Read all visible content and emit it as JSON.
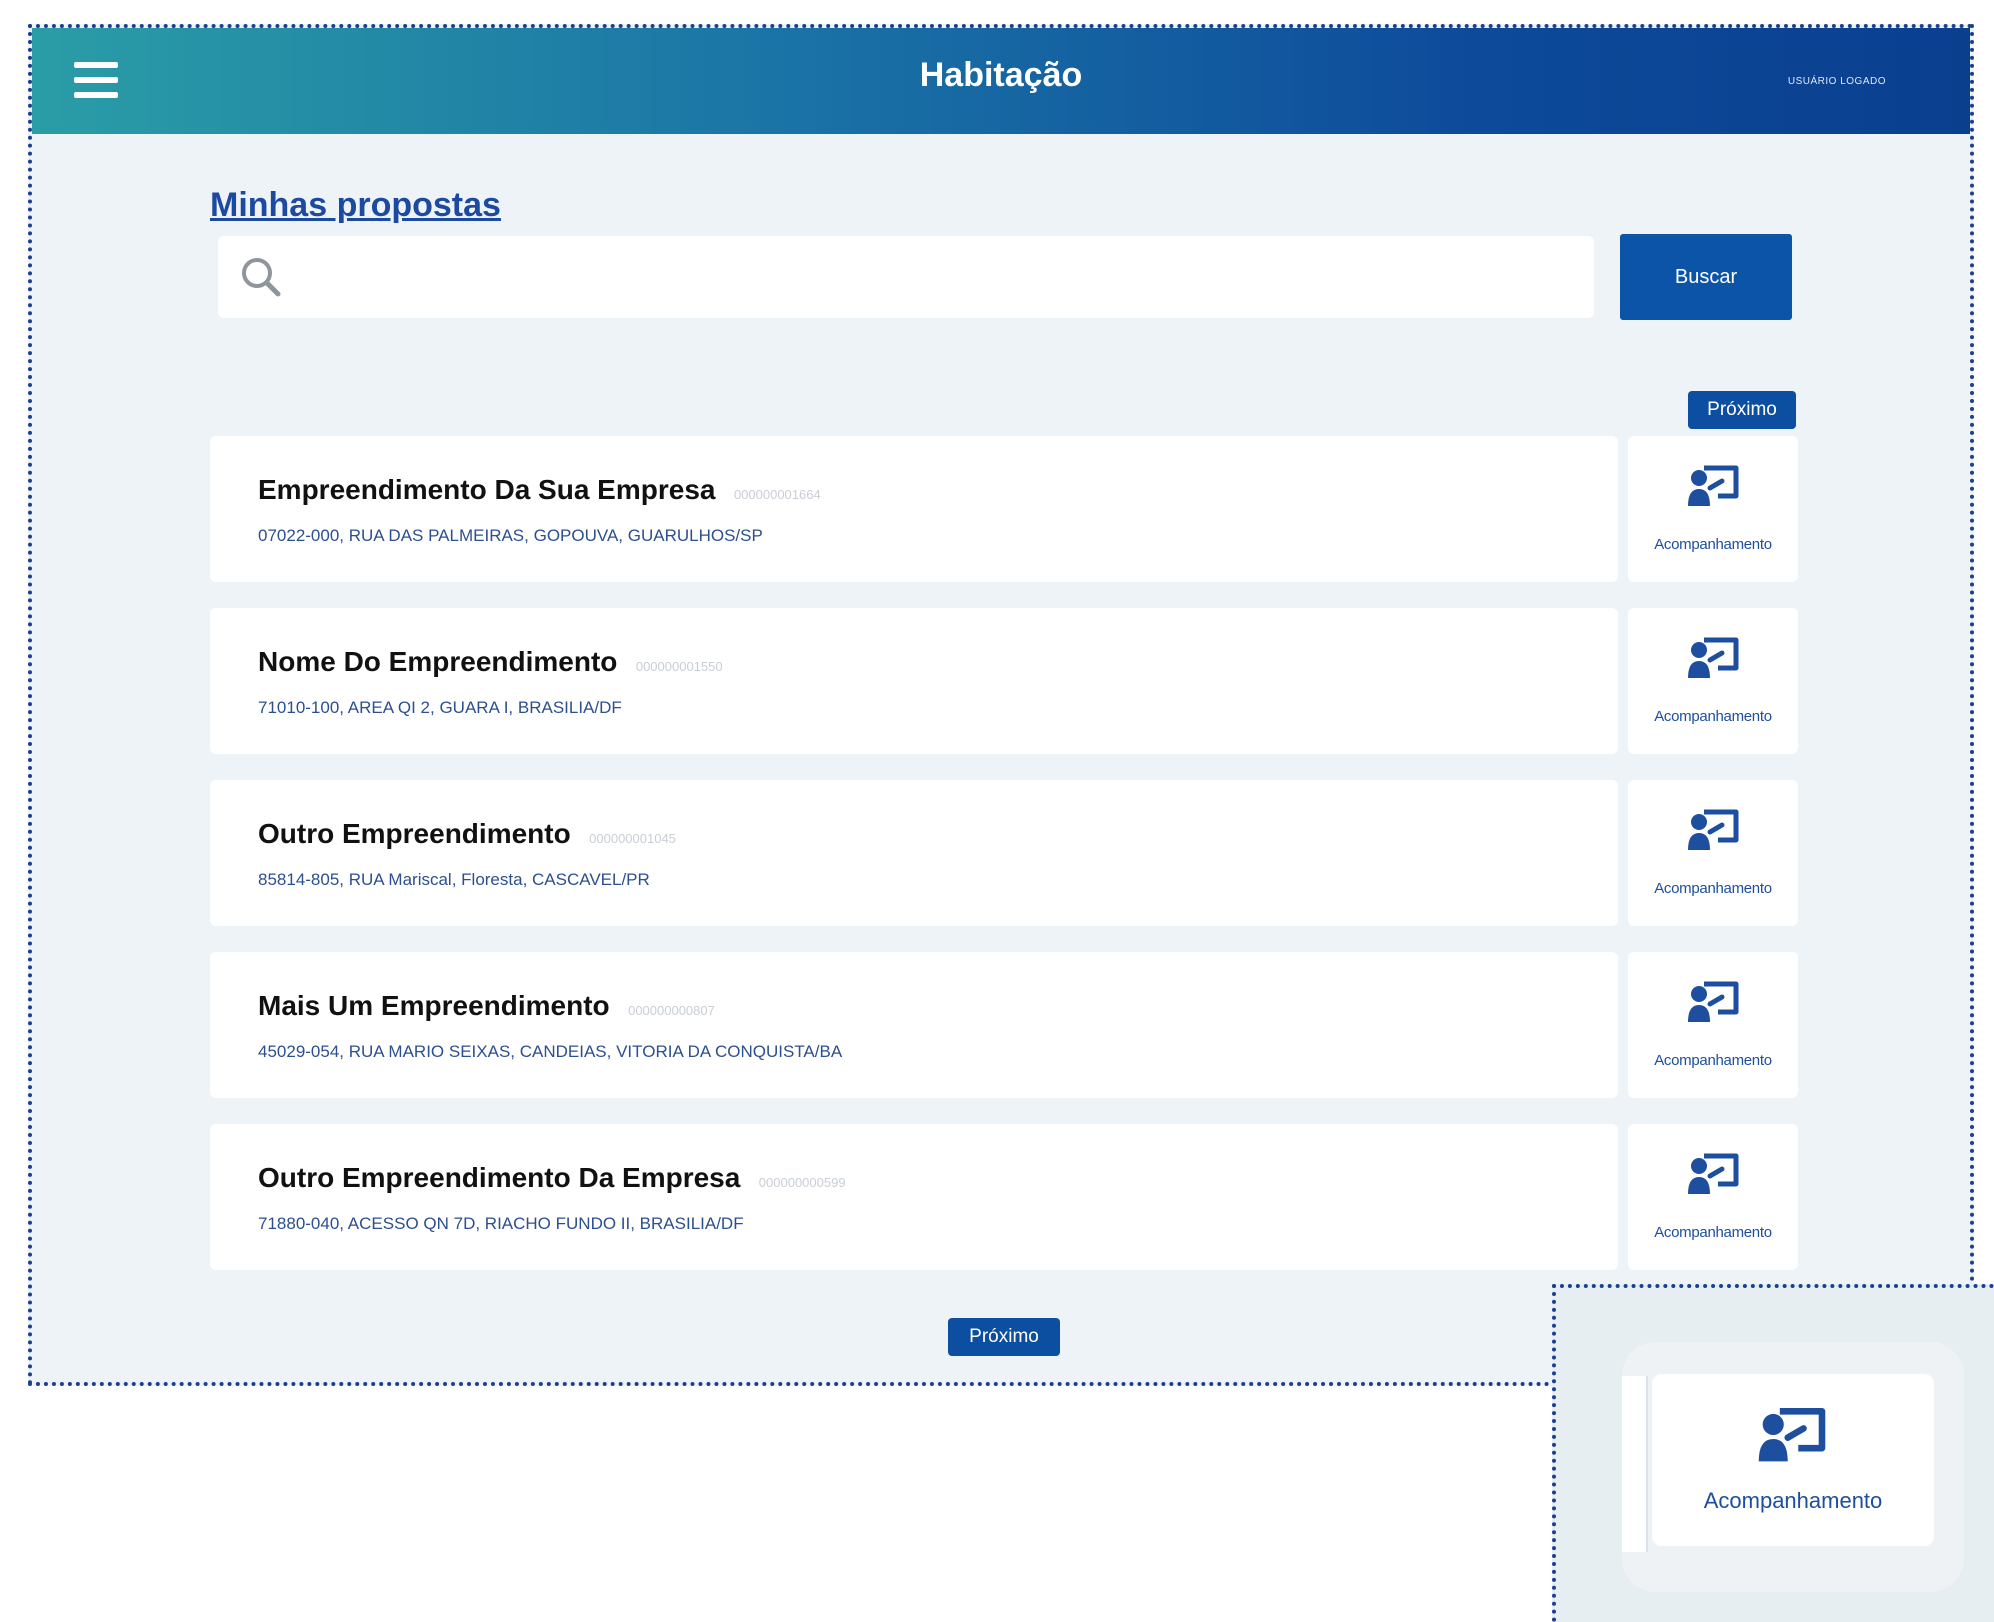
{
  "header": {
    "title": "Habitação",
    "user_text": "USUÁRIO LOGADO"
  },
  "page": {
    "title": "Minhas propostas"
  },
  "search": {
    "placeholder": "",
    "value": "",
    "button_label": "Buscar"
  },
  "pagination": {
    "next_label": "Próximo"
  },
  "proposals": [
    {
      "name": "Empreendimento Da Sua Empresa",
      "code": "000000001664",
      "address": "07022-000, RUA DAS PALMEIRAS, GOPOUVA, GUARULHOS/SP",
      "action_label": "Acompanhamento"
    },
    {
      "name": "Nome Do Empreendimento",
      "code": "000000001550",
      "address": "71010-100, AREA QI 2, GUARA I, BRASILIA/DF",
      "action_label": "Acompanhamento"
    },
    {
      "name": "Outro Empreendimento",
      "code": "000000001045",
      "address": "85814-805, RUA Mariscal, Floresta, CASCAVEL/PR",
      "action_label": "Acompanhamento"
    },
    {
      "name": "Mais Um Empreendimento",
      "code": "000000000807",
      "address": "45029-054, RUA MARIO SEIXAS, CANDEIAS, VITORIA DA CONQUISTA/BA",
      "action_label": "Acompanhamento"
    },
    {
      "name": "Outro Empreendimento Da Empresa",
      "code": "000000000599",
      "address": "71880-040, ACESSO QN 7D, RIACHO FUNDO II, BRASILIA/DF",
      "action_label": "Acompanhamento"
    }
  ],
  "zoom": {
    "action_label": "Acompanhamento"
  },
  "colors": {
    "header_start": "#2a9da6",
    "header_end": "#0a3f8e",
    "primary": "#0c54a8",
    "background": "#eef3f8",
    "link": "#1b4aa0"
  },
  "icons": {
    "menu": "hamburger-menu-icon",
    "search": "magnifier-icon",
    "track": "person-presentation-board-icon"
  }
}
